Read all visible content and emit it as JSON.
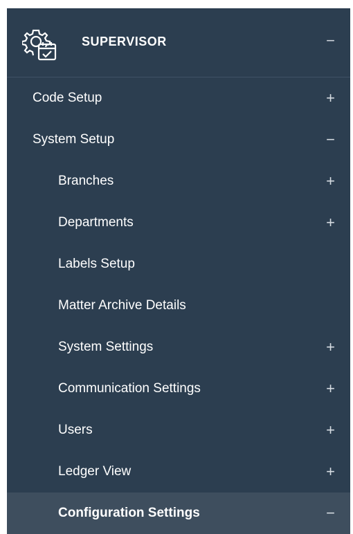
{
  "header": {
    "title": "SUPERVISOR",
    "toggle": "−",
    "icon": "settings-calendar-icon"
  },
  "menu": [
    {
      "label": "Code Setup",
      "toggle": "+",
      "level": 1
    },
    {
      "label": "System Setup",
      "toggle": "−",
      "level": 1
    },
    {
      "label": "Branches",
      "toggle": "+",
      "level": 2
    },
    {
      "label": "Departments",
      "toggle": "+",
      "level": 2
    },
    {
      "label": "Labels Setup",
      "toggle": "",
      "level": 2
    },
    {
      "label": "Matter Archive Details",
      "toggle": "",
      "level": 2
    },
    {
      "label": "System Settings",
      "toggle": "+",
      "level": 2
    },
    {
      "label": "Communication Settings",
      "toggle": "+",
      "level": 2
    },
    {
      "label": "Users",
      "toggle": "+",
      "level": 2
    },
    {
      "label": "Ledger View",
      "toggle": "+",
      "level": 2
    },
    {
      "label": "Configuration Settings",
      "toggle": "−",
      "level": 2
    }
  ],
  "colors": {
    "panel_bg": "#2c3e50",
    "active_bg": "#3e4e5e",
    "text": "#ffffff"
  }
}
